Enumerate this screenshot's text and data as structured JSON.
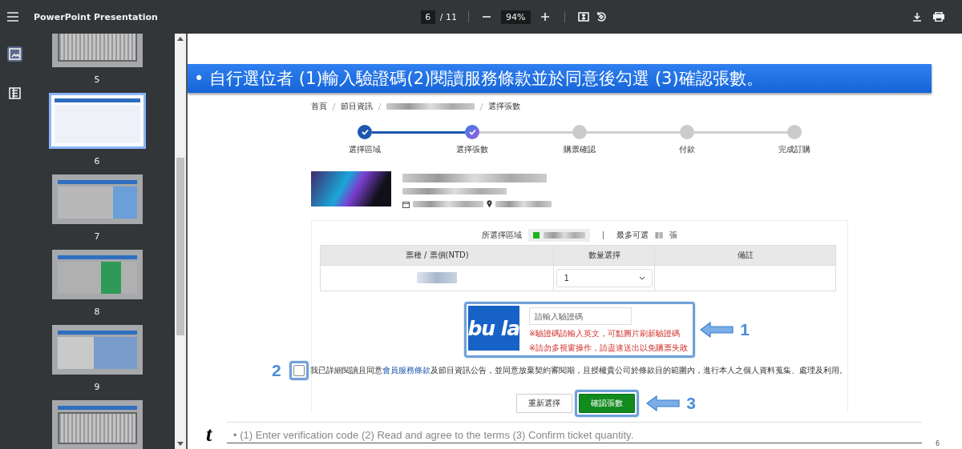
{
  "toolbar": {
    "title": "PowerPoint Presentation",
    "page": "6",
    "page_total": "/ 11",
    "zoom": "94%"
  },
  "sidebar": {
    "views": [
      {
        "kind": "thumbnails",
        "selected": true
      },
      {
        "kind": "outline",
        "selected": false
      }
    ],
    "pages": [
      {
        "label": "5",
        "kind": "grid",
        "selected": false
      },
      {
        "label": "6",
        "kind": "form",
        "selected": true
      },
      {
        "label": "7",
        "kind": "popup",
        "selected": false
      },
      {
        "label": "8",
        "kind": "payment",
        "selected": false
      },
      {
        "label": "9",
        "kind": "split",
        "selected": false
      },
      {
        "kind": "grid",
        "selected": false
      }
    ]
  },
  "slide": {
    "heading": "• 自行選位者 (1)輸入驗證碼(2)閱讀服務條款並於同意後勾選 (3)確認張數。",
    "breadcrumb": [
      "首頁",
      "節目資訊",
      "選擇張數"
    ],
    "steps": [
      {
        "label": "選擇區域",
        "completed": true,
        "selected": false
      },
      {
        "label": "選擇張數",
        "completed": true,
        "selected": true
      },
      {
        "label": "購票確認",
        "completed": false,
        "selected": false
      },
      {
        "label": "付款",
        "completed": false,
        "selected": false
      },
      {
        "label": "完成訂購",
        "completed": false,
        "selected": false
      }
    ],
    "area_label": "所選擇區域",
    "max_prefix": "最多可選",
    "max_suffix": "張",
    "table": {
      "columns": [
        "票種 / 票價(NTD)",
        "數量選擇",
        "備註"
      ],
      "rows": [
        {
          "quantity": "1"
        }
      ]
    },
    "captcha": {
      "image_text": "bu la",
      "placeholder": "請輸入驗證碼",
      "notes": [
        "※驗證碼請輸入英文，可點圖片刷新驗證碼",
        "※請勿多視窗操作，請盡速送出以免購票失敗"
      ],
      "callout": "1"
    },
    "agreement": {
      "before": "我已詳細閱讀且同意",
      "link": "會員服務條款",
      "after": "及節目資訊公告，並同意放棄契約審閱期，且授權貴公司於條款目的範圍內，進行本人之個人資料蒐集、處理及利用。",
      "checked": false,
      "callout": "2"
    },
    "buttons": [
      {
        "label": "重新選擇",
        "kind": "secondary"
      },
      {
        "label": "確認張數",
        "kind": "primary",
        "callout": "3"
      }
    ],
    "footnote": "• (1) Enter verification code (2) Read and agree to the terms (3) Confirm ticket quantity.",
    "corner_mark": "t",
    "page_number": "6"
  }
}
